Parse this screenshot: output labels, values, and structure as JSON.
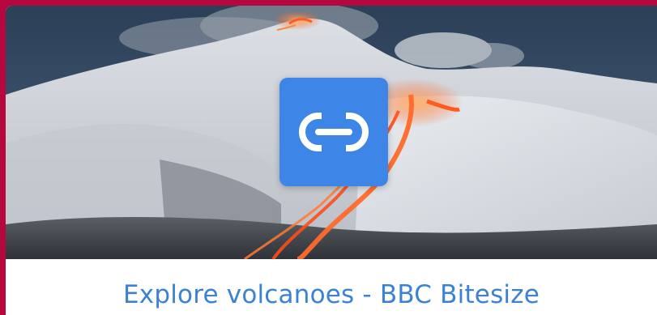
{
  "card": {
    "title": "Explore volcanoes - BBC Bitesize",
    "image_subject": "snow-covered volcano with lava flows",
    "badge_icon": "link-icon"
  },
  "colors": {
    "frame": "#b5083f",
    "badge": "#3d86e8",
    "title_link": "#3b82d6",
    "lava": "#ff5a1f"
  }
}
